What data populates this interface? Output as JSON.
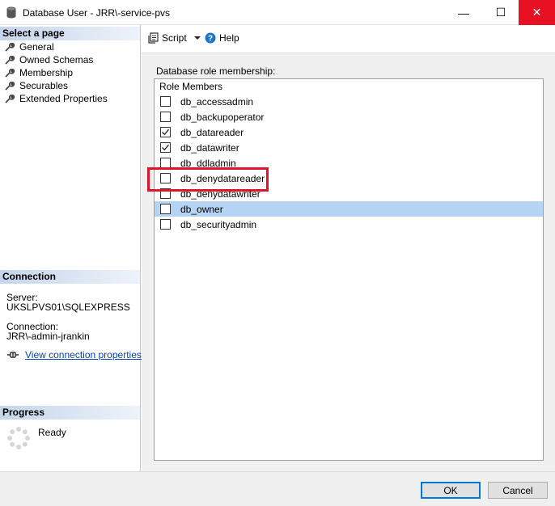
{
  "window": {
    "title": "Database User - JRR\\-service-pvs",
    "minimize_symbol": "—",
    "maximize_symbol": "☐",
    "close_symbol": "✕"
  },
  "left": {
    "select_page_header": "Select a page",
    "pages": [
      {
        "label": "General",
        "icon": "wrench-icon"
      },
      {
        "label": "Owned Schemas",
        "icon": "wrench-icon"
      },
      {
        "label": "Membership",
        "icon": "wrench-icon"
      },
      {
        "label": "Securables",
        "icon": "wrench-icon"
      },
      {
        "label": "Extended Properties",
        "icon": "wrench-icon"
      }
    ],
    "connection_header": "Connection",
    "server_label": "Server:",
    "server_value": "UKSLPVS01\\SQLEXPRESS",
    "connection_label": "Connection:",
    "connection_value": "JRR\\-admin-jrankin",
    "view_connection_link": "View connection properties",
    "progress_header": "Progress",
    "progress_status": "Ready"
  },
  "toolbar": {
    "script_label": "Script",
    "help_label": "Help"
  },
  "main": {
    "group_label": "Database role membership:",
    "list_header": "Role Members",
    "roles": [
      {
        "name": "db_accessadmin",
        "checked": false,
        "selected": false
      },
      {
        "name": "db_backupoperator",
        "checked": false,
        "selected": false
      },
      {
        "name": "db_datareader",
        "checked": true,
        "selected": false
      },
      {
        "name": "db_datawriter",
        "checked": true,
        "selected": false
      },
      {
        "name": "db_ddladmin",
        "checked": false,
        "selected": false
      },
      {
        "name": "db_denydatareader",
        "checked": false,
        "selected": false
      },
      {
        "name": "db_denydatawriter",
        "checked": false,
        "selected": false
      },
      {
        "name": "db_owner",
        "checked": false,
        "selected": true
      },
      {
        "name": "db_securityadmin",
        "checked": false,
        "selected": false
      }
    ]
  },
  "buttons": {
    "ok_label": "OK",
    "cancel_label": "Cancel"
  },
  "colors": {
    "selection": "#b5d3f3",
    "highlight_box": "#e0152b",
    "close_button": "#e81123",
    "link": "#0645ad"
  }
}
